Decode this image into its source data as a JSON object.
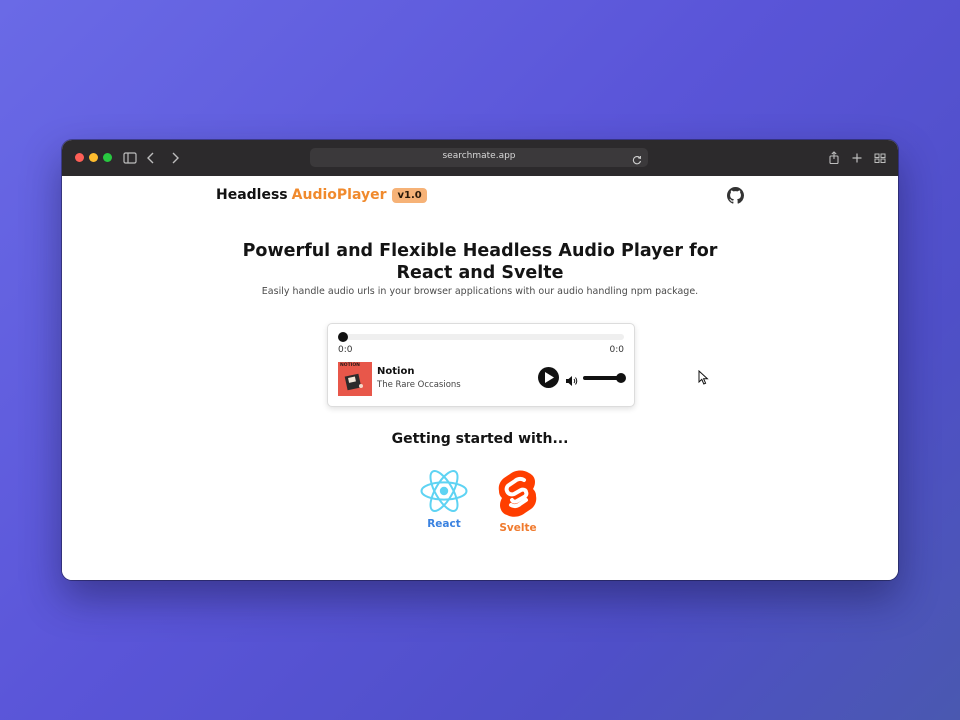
{
  "browser": {
    "url": "searchmate.app"
  },
  "header": {
    "logo_prefix": "Headless",
    "logo_accent": "AudioPlayer",
    "version": "v1.0"
  },
  "hero": {
    "title": "Powerful and Flexible Headless Audio Player for React and Svelte",
    "subtitle": "Easily handle audio urls in your browser applications with our audio handling npm package."
  },
  "player": {
    "current_time": "0:0",
    "duration": "0:0",
    "progress": 0,
    "volume": 1,
    "song_title": "Notion",
    "song_artist": "The Rare Occasions",
    "cover_label": "NOTION"
  },
  "getting_started": {
    "title": "Getting started with...",
    "frameworks": [
      {
        "label": "React"
      },
      {
        "label": "Svelte"
      }
    ]
  },
  "colors": {
    "accent": "#f08a2d",
    "react": "#3a82e0",
    "svelte": "#f07a2d"
  }
}
